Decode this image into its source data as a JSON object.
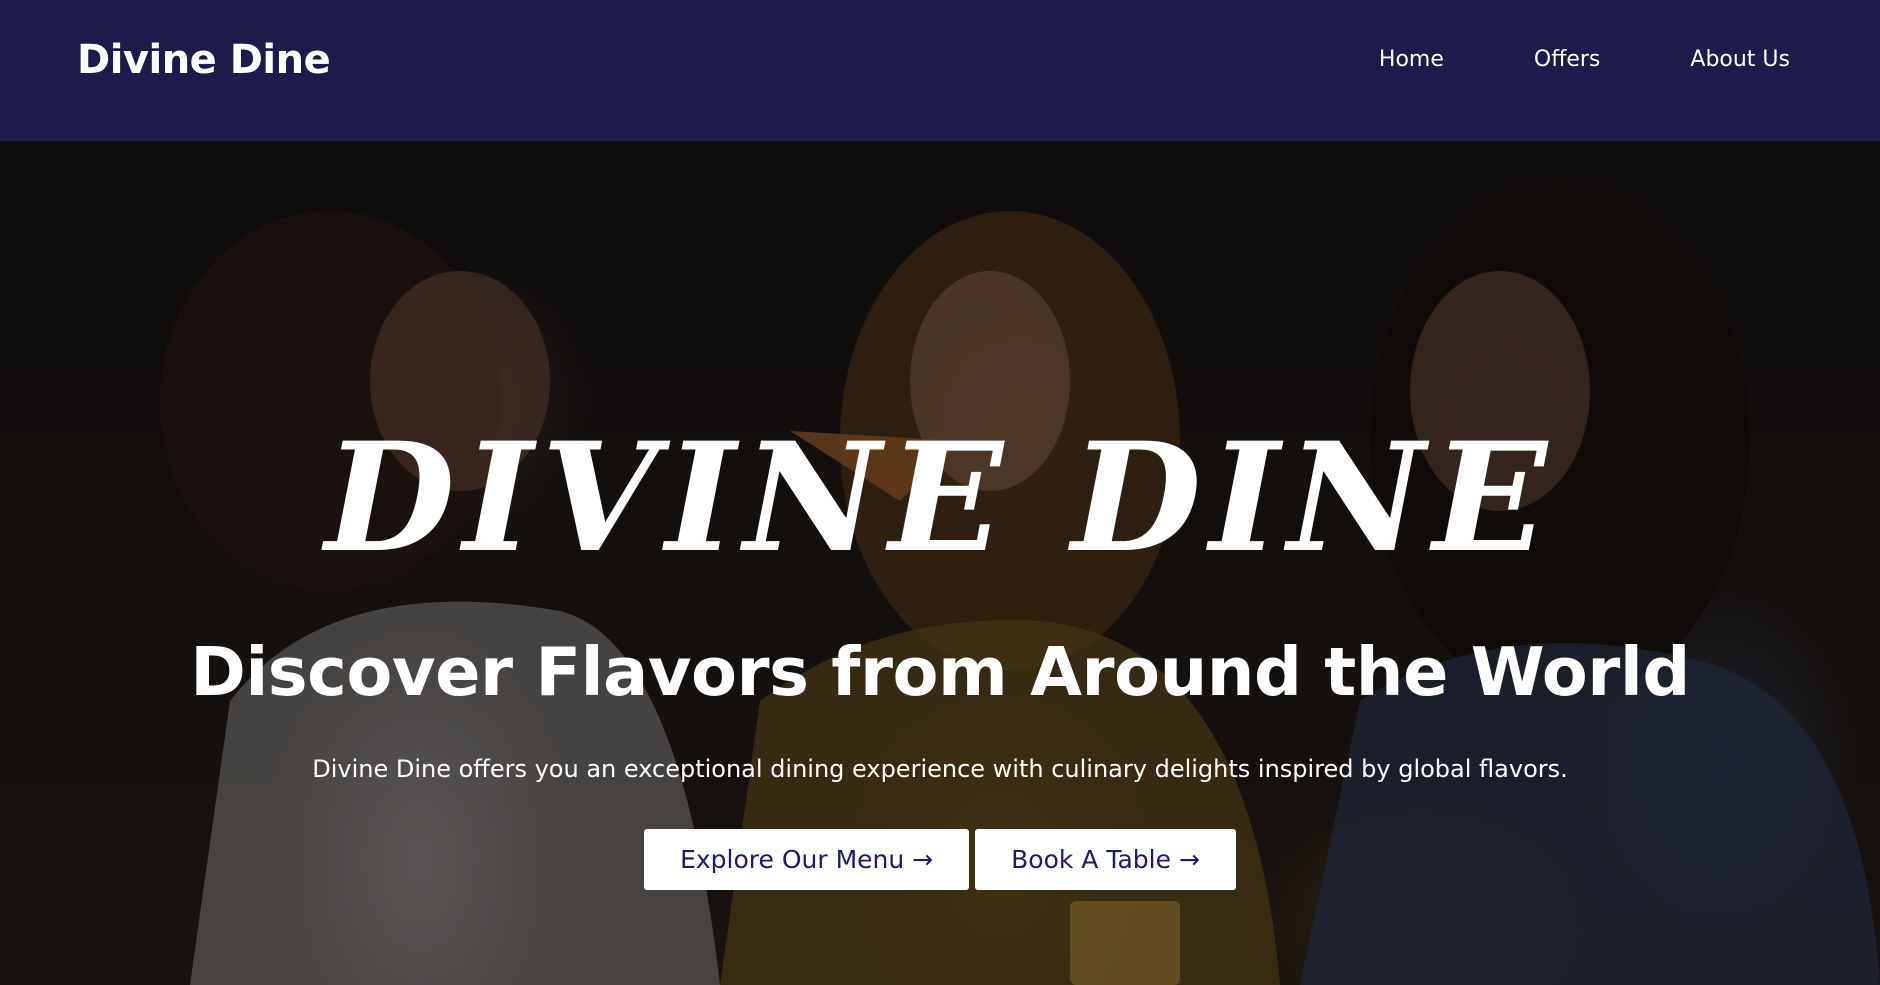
{
  "navbar": {
    "brand": "Divine Dine",
    "links": [
      {
        "label": "Home"
      },
      {
        "label": "Offers"
      },
      {
        "label": "About Us"
      }
    ],
    "background": "#1c1b4a"
  },
  "hero": {
    "display_title": "DIVINE DINE",
    "headline": "Discover Flavors from Around the World",
    "tagline": "Divine Dine offers you an exceptional dining experience with culinary delights inspired by global flavors.",
    "buttons": [
      {
        "label": "Explore Our Menu →"
      },
      {
        "label": "Book A Table →"
      }
    ],
    "button_text_color": "#1b1a6e"
  }
}
